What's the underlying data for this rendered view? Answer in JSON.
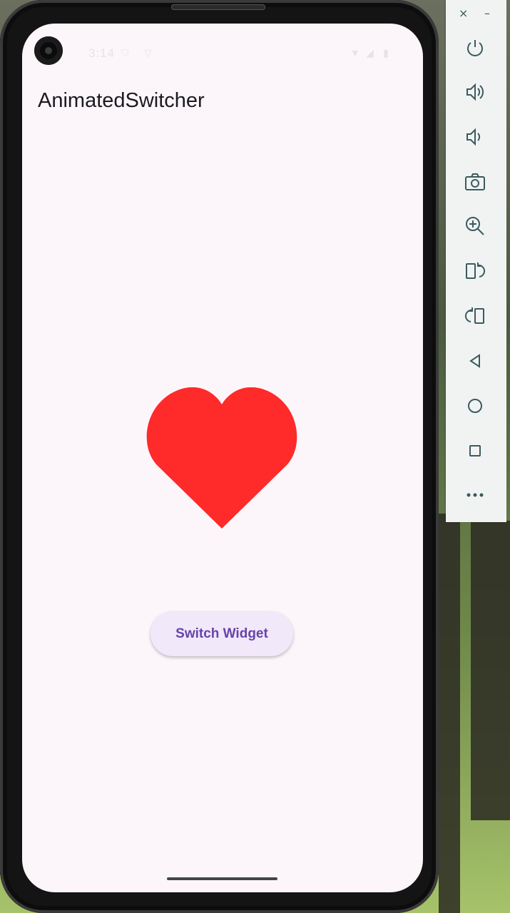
{
  "app": {
    "title": "AnimatedSwitcher",
    "button_label": "Switch Widget"
  },
  "status_bar": {
    "time": "3:14"
  },
  "colors": {
    "heart": "#ff2a2a",
    "button_bg": "#f1e8fa",
    "button_text": "#6744a8",
    "screen_bg": "#fcf6fb"
  },
  "emulator_toolbar": {
    "close": "×",
    "minimize": "–",
    "buttons": [
      {
        "icon": "power-icon"
      },
      {
        "icon": "volume-up-icon"
      },
      {
        "icon": "volume-down-icon"
      },
      {
        "icon": "camera-icon"
      },
      {
        "icon": "zoom-in-icon"
      },
      {
        "icon": "rotate-left-icon"
      },
      {
        "icon": "rotate-right-icon"
      },
      {
        "icon": "back-icon"
      },
      {
        "icon": "home-icon"
      },
      {
        "icon": "overview-icon"
      },
      {
        "icon": "more-icon"
      }
    ]
  }
}
